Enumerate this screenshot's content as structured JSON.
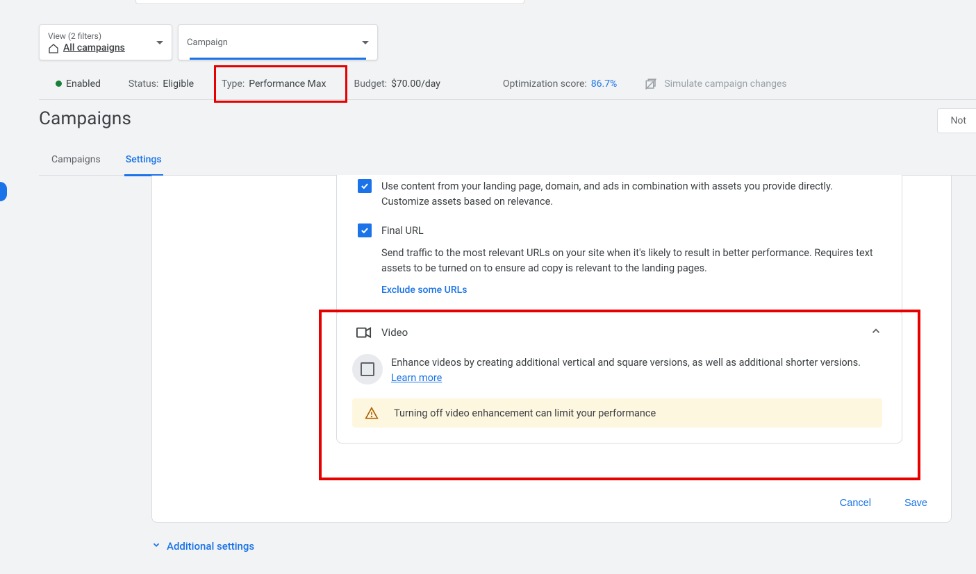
{
  "filters": {
    "view_label": "View (2 filters)",
    "view_value": "All campaigns",
    "campaign_label": "Campaign"
  },
  "status_bar": {
    "enabled": "Enabled",
    "status_label": "Status:",
    "status_value": "Eligible",
    "type_label": "Type:",
    "type_value": "Performance Max",
    "budget_label": "Budget:",
    "budget_value": "$70.00/day",
    "opt_label": "Optimization score:",
    "opt_value": "86.7%",
    "simulate": "Simulate campaign changes"
  },
  "page_title": "Campaigns",
  "right_btn": "Not",
  "tabs": {
    "campaigns": "Campaigns",
    "settings": "Settings"
  },
  "text_assets": {
    "desc": "Use content from your landing page, domain, and ads in combination with assets you provide directly. Customize assets based on relevance."
  },
  "final_url": {
    "title": "Final URL",
    "desc": "Send traffic to the most relevant URLs on your site when it's likely to result in better performance. Requires text assets to be turned on to ensure ad copy is relevant to the landing pages.",
    "exclude": "Exclude some URLs"
  },
  "video": {
    "title": "Video",
    "enhance_desc": "Enhance videos by creating additional vertical and square versions, as well as additional shorter versions. ",
    "learn_more": "Learn more",
    "warning": "Turning off video enhancement can limit your performance"
  },
  "actions": {
    "cancel": "Cancel",
    "save": "Save"
  },
  "additional": "Additional settings"
}
